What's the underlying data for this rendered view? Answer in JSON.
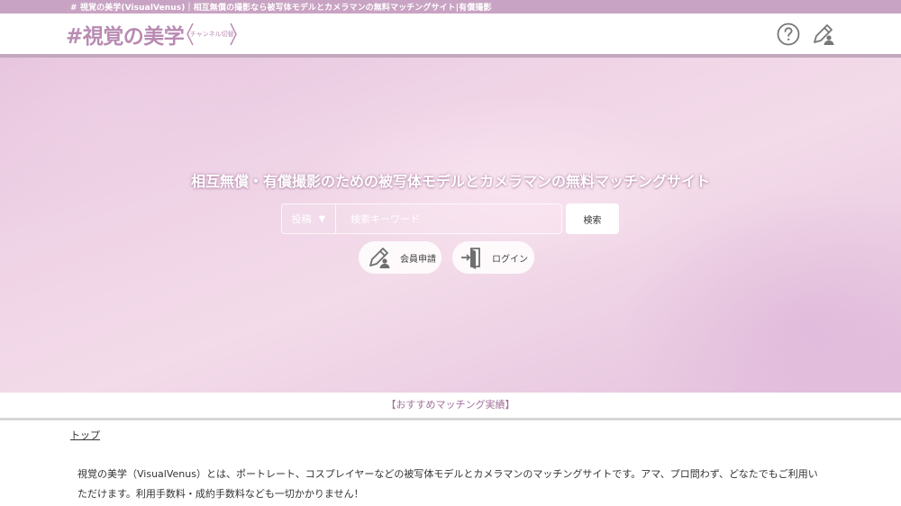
{
  "top_strip": {
    "text": "# 視覚の美学(VisualVenus)｜相互無償の撮影なら被写体モデルとカメラマンの無料マッチングサイト|有償撮影"
  },
  "header": {
    "logo": "#視覚の美学",
    "channel_switch": "チャンネル切替",
    "help_icon": "help-icon",
    "register_icon": "pen-icon"
  },
  "hero": {
    "title": "相互無償・有償撮影のための被写体モデルとカメラマンの無料マッチングサイト",
    "search": {
      "type_selected": "投稿",
      "type_arrow": "▼",
      "placeholder": "検索キーワード",
      "value": "",
      "button": "検索"
    },
    "register_label": "会員申請",
    "login_label": "ログイン"
  },
  "recommend": {
    "label": "【おすすめマッチング実績】"
  },
  "breadcrumb": {
    "label": "トップ"
  },
  "description": {
    "text": "視覚の美学（VisualVenus）とは、ポートレート、コスプレイヤーなどの被写体モデルとカメラマンのマッチングサイトです。アマ、プロ問わず、どなたでもご利用いただけます。利用手数料・成約手数料なども一切かかりません！"
  },
  "colors": {
    "brand": "#b98bb3",
    "top_strip": "#c9a3c3",
    "recommend_text": "#a3729b"
  }
}
